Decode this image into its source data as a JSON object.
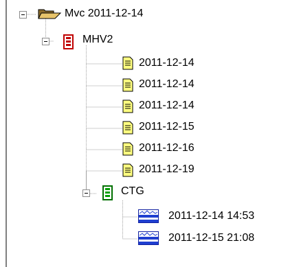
{
  "tree": {
    "root": {
      "label": "Mvc 2011-12-14",
      "icon": "folder-open-icon",
      "expanded": true,
      "children": [
        {
          "label": "MHV2",
          "icon": "red-device-icon",
          "expanded": true,
          "children": [
            {
              "label": "2011-12-14",
              "icon": "document-icon"
            },
            {
              "label": "2011-12-14",
              "icon": "document-icon"
            },
            {
              "label": "2011-12-14",
              "icon": "document-icon"
            },
            {
              "label": "2011-12-15",
              "icon": "document-icon"
            },
            {
              "label": "2011-12-16",
              "icon": "document-icon"
            },
            {
              "label": "2011-12-19",
              "icon": "document-icon"
            }
          ]
        },
        {
          "label": "CTG",
          "icon": "green-device-icon",
          "expanded": true,
          "children": [
            {
              "label": "2011-12-14 14:53",
              "icon": "waveform-icon"
            },
            {
              "label": "2011-12-15 21:08",
              "icon": "waveform-icon"
            }
          ]
        }
      ]
    }
  }
}
